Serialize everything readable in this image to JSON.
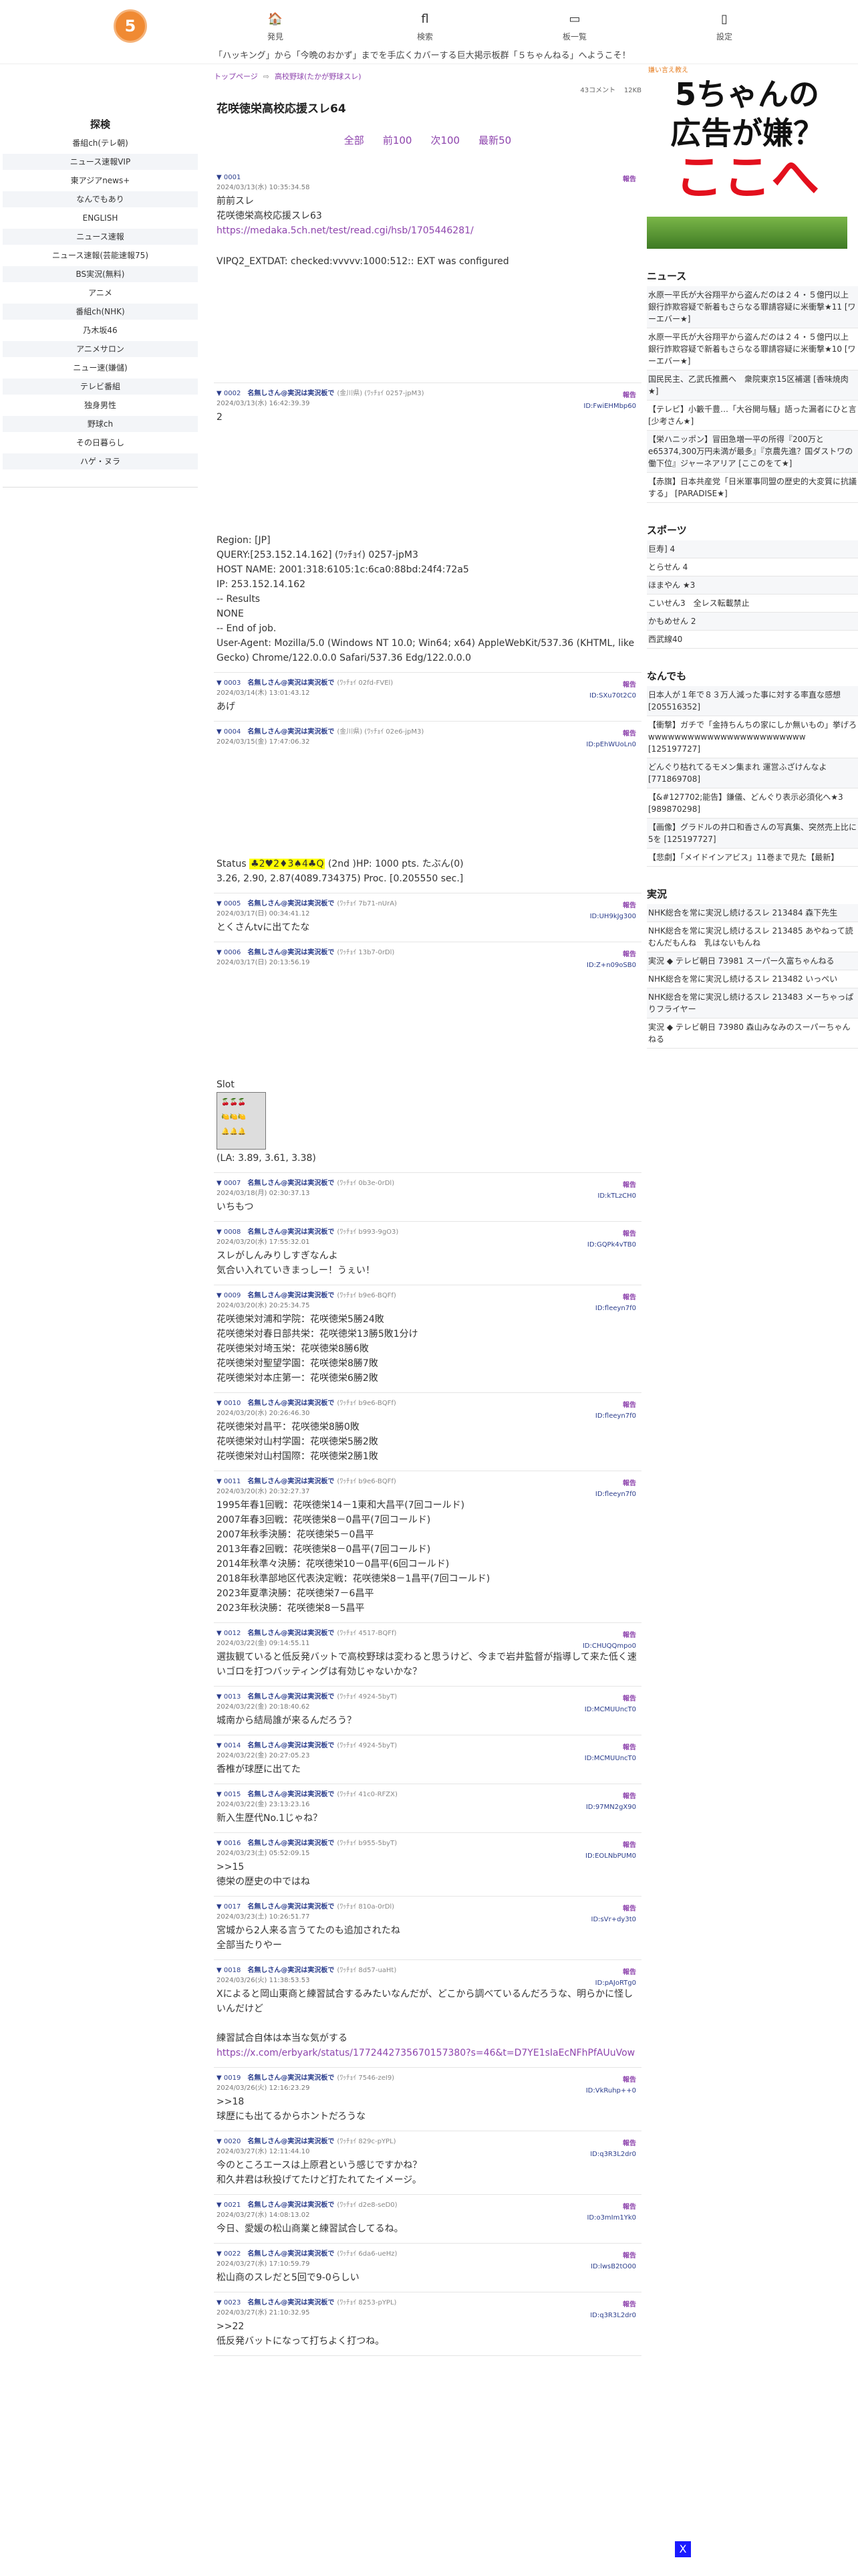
{
  "nav": {
    "logo": "5",
    "items": [
      {
        "icon": "🏠",
        "label": "発見"
      },
      {
        "icon": "fl",
        "label": "検索"
      },
      {
        "icon": "▭",
        "label": "板一覧"
      },
      {
        "icon": "▯",
        "label": "設定"
      }
    ]
  },
  "marquee": "「ハッキング」から「今晩のおかず」までを手広くカバーする巨大掲示板群「５ちゃんねる」へようこそ！",
  "sidebar": {
    "title": "探検",
    "items": [
      "番組ch(テレ朝)",
      "ニュース速報VIP",
      "東アジアnews+",
      "なんでもあり",
      "ENGLISH",
      "ニュース速報",
      "ニュース速報(芸能速報75)",
      "BS実況(無料)",
      "アニメ",
      "番組ch(NHK)",
      "乃木坂46",
      "アニメサロン",
      "ニュー速(嫌儲)",
      "テレビ番組",
      "独身男性",
      "野球ch",
      "その日暮らし",
      "ハゲ・ヌラ"
    ]
  },
  "breadcrumb": [
    "トップページ",
    "高校野球(たかが野球スレ)"
  ],
  "meta": {
    "comments": "43コメント",
    "size": "12KB"
  },
  "thread_title": "花咲徳栄高校応援スレ64",
  "pager": [
    "全部",
    "前100",
    "次100",
    "最新50"
  ],
  "report_label": "報告",
  "posts": [
    {
      "num": "0001",
      "name": "",
      "trip": "",
      "date": "2024/03/13(水) 10:35:34.58",
      "id": "",
      "body": "前前スレ\n花咲徳栄高校応援スレ63",
      "link": "https://medaka.5ch.net/test/read.cgi/hsb/1705446281/",
      "after": "\nVIPQ2_EXTDAT: checked:vvvvv:1000:512:: EXT was configured",
      "blank": true
    },
    {
      "num": "0002",
      "name": "名無しさん@実況は実況板で",
      "trip": "(金川県) (ﾜｯﾁｮｲ 0257-jpM3)",
      "date": "2024/03/13(水) 16:42:39.39",
      "id": "ID:FwiEHMbp60",
      "body": "2",
      "blank": true,
      "after2": "Region: [JP]\nQUERY:[253.152.14.162] (ﾜｯﾁｮｲ) 0257-jpM3\nHOST NAME: 2001:318:6105:1c:6ca0:88bd:24f4:72a5\nIP: 253.152.14.162\n-- Results\nNONE\n-- End of job.\nUser-Agent: Mozilla/5.0 (Windows NT 10.0; Win64; x64) AppleWebKit/537.36 (KHTML, like Gecko) Chrome/122.0.0.0 Safari/537.36 Edg/122.0.0.0"
    },
    {
      "num": "0003",
      "name": "名無しさん@実況は実況板で",
      "trip": "(ﾜｯﾁｮｲ 02fd-FVEl)",
      "date": "2024/03/14(木) 13:01:43.12",
      "id": "ID:SXu70t2C0",
      "body": "あげ"
    },
    {
      "num": "0004",
      "name": "名無しさん@実況は実況板で",
      "trip": "(金川県) (ﾜｯﾁｮｲ 02e6-jpM3)",
      "date": "2024/03/15(金) 17:47:06.32",
      "id": "ID:pEhWUoLn0",
      "body": "",
      "blank": true,
      "status": true
    },
    {
      "num": "0005",
      "name": "名無しさん@実況は実況板で",
      "trip": "(ﾜｯﾁｮｲ 7b71-nUrA)",
      "date": "2024/03/17(日) 00:34:41.12",
      "id": "ID:UH9kJg300",
      "body": "とくさんtvに出てたな"
    },
    {
      "num": "0006",
      "name": "名無しさん@実況は実況板で",
      "trip": "(ﾜｯﾁｮｲ 13b7-0rDl)",
      "date": "2024/03/17(日) 20:13:56.19",
      "id": "ID:Z+n09oSB0",
      "body": "",
      "blank": true,
      "slot": true
    },
    {
      "num": "0007",
      "name": "名無しさん@実況は実況板で",
      "trip": "(ﾜｯﾁｮｲ 0b3e-0rDl)",
      "date": "2024/03/18(月) 02:30:37.13",
      "id": "ID:kTLzCH0",
      "body": "いちもつ"
    },
    {
      "num": "0008",
      "name": "名無しさん@実況は実況板で",
      "trip": "(ﾜｯﾁｮｲ b993-9gO3)",
      "date": "2024/03/20(水) 17:55:32.01",
      "id": "ID:GQPk4vTB0",
      "body": "スレがしんみりしすぎなんよ\n気合い入れていきまっしー！うぇい！"
    },
    {
      "num": "0009",
      "name": "名無しさん@実況は実況板で",
      "trip": "(ﾜｯﾁｮｲ b9e6-BQFf)",
      "date": "2024/03/20(水) 20:25:34.75",
      "id": "ID:fleeyn7f0",
      "body": "花咲徳栄対浦和学院：花咲徳栄5勝24敗\n花咲徳栄対春日部共栄：花咲徳栄13勝5敗1分け\n花咲徳栄対埼玉栄：花咲徳栄8勝6敗\n花咲徳栄対聖望学園：花咲徳栄8勝7敗\n花咲徳栄対本庄第一：花咲徳栄6勝2敗"
    },
    {
      "num": "0010",
      "name": "名無しさん@実況は実況板で",
      "trip": "(ﾜｯﾁｮｲ b9e6-BQFf)",
      "date": "2024/03/20(水) 20:26:46.30",
      "id": "ID:fleeyn7f0",
      "body": "花咲徳栄対昌平：花咲徳栄8勝0敗\n花咲徳栄対山村学園：花咲徳栄5勝2敗\n花咲徳栄対山村国際：花咲徳栄2勝1敗"
    },
    {
      "num": "0011",
      "name": "名無しさん@実況は実況板で",
      "trip": "(ﾜｯﾁｮｲ b9e6-BQFf)",
      "date": "2024/03/20(水) 20:32:27.37",
      "id": "ID:fleeyn7f0",
      "body": "1995年春1回戦：花咲徳栄14－1東和大昌平(7回コールド)\n2007年春3回戦：花咲徳栄8－0昌平(7回コールド)\n2007年秋季決勝：花咲徳栄5－0昌平\n2013年春2回戦：花咲徳栄8－0昌平(7回コールド)\n2014年秋準々決勝：花咲徳栄10－0昌平(6回コールド)\n2018年秋準部地区代表決定戦：花咲徳栄8－1昌平(7回コールド)\n2023年夏準決勝：花咲徳栄7－6昌平\n2023年秋決勝：花咲徳栄8－5昌平"
    },
    {
      "num": "0012",
      "name": "名無しさん@実況は実況板で",
      "trip": "(ﾜｯﾁｮｲ 4517-BQFf)",
      "date": "2024/03/22(金) 09:14:55.11",
      "id": "ID:CHUQQmpo0",
      "body": "選抜観ていると低反発バットで高校野球は変わると思うけど、今まで岩井監督が指導して来た低く速いゴロを打つバッティングは有効じゃないかな？"
    },
    {
      "num": "0013",
      "name": "名無しさん@実況は実況板で",
      "trip": "(ﾜｯﾁｮｲ 4924-5byT)",
      "date": "2024/03/22(金) 20:18:40.62",
      "id": "ID:MCMUUncT0",
      "body": "城南から結局誰が来るんだろう？"
    },
    {
      "num": "0014",
      "name": "名無しさん@実況は実況板で",
      "trip": "(ﾜｯﾁｮｲ 4924-5byT)",
      "date": "2024/03/22(金) 20:27:05.23",
      "id": "ID:MCMUUncT0",
      "body": "香椎が球歴に出てた"
    },
    {
      "num": "0015",
      "name": "名無しさん@実況は実況板で",
      "trip": "(ﾜｯﾁｮｲ 41c0-RFZX)",
      "date": "2024/03/22(金) 23:13:23.16",
      "id": "ID:97MN2gX90",
      "body": "新入生歴代No.1じゃね？"
    },
    {
      "num": "0016",
      "name": "名無しさん@実況は実況板で",
      "trip": "(ﾜｯﾁｮｲ b955-5byT)",
      "date": "2024/03/23(土) 05:52:09.15",
      "id": "ID:EOLNbPUM0",
      "body": ">>15\n徳栄の歴史の中ではね",
      "quote": true
    },
    {
      "num": "0017",
      "name": "名無しさん@実況は実況板で",
      "trip": "(ﾜｯﾁｮｲ 810a-0rDl)",
      "date": "2024/03/23(土) 10:26:51.77",
      "id": "ID:sVr+dy3t0",
      "body": "宮城から2人来る言うてたのも追加されたね\n全部当たりやー"
    },
    {
      "num": "0018",
      "name": "名無しさん@実況は実況板で",
      "trip": "(ﾜｯﾁｮｲ 8d57-uaHt)",
      "date": "2024/03/26(火) 11:38:53.53",
      "id": "ID:pAJoRTg0",
      "body": "Xによると岡山東商と練習試合するみたいなんだが、どこから調べているんだろうな、明らかに怪しいんだけど\n\n練習試合自体は本当な気がする",
      "link": "https://x.com/erbyark/status/1772442735670157380?s=46&t=D7YE1sIaEcNFhPfAUuVow"
    },
    {
      "num": "0019",
      "name": "名無しさん@実況は実況板で",
      "trip": "(ﾜｯﾁｮｲ 7546-zeI9)",
      "date": "2024/03/26(火) 12:16:23.29",
      "id": "ID:VkRuhp++0",
      "body": ">>18\n球歴にも出てるからホントだろうな",
      "quote": true
    },
    {
      "num": "0020",
      "name": "名無しさん@実況は実況板で",
      "trip": "(ﾜｯﾁｮｲ 829c-pYPL)",
      "date": "2024/03/27(水) 12:11:44.10",
      "id": "ID:q3R3L2dr0",
      "body": "今のところエースは上原君という感じですかね？\n和久井君は秋投げてたけど打たれてたイメージ。"
    },
    {
      "num": "0021",
      "name": "名無しさん@実況は実況板で",
      "trip": "(ﾜｯﾁｮｲ d2e8-seD0)",
      "date": "2024/03/27(水) 14:08:13.02",
      "id": "ID:o3mIm1Yk0",
      "body": "今日、愛媛の松山商業と練習試合してるね。"
    },
    {
      "num": "0022",
      "name": "名無しさん@実況は実況板で",
      "trip": "(ﾜｯﾁｮｲ 6da6-ueHz)",
      "date": "2024/03/27(水) 17:10:59.79",
      "id": "ID:lwsB2tO00",
      "body": "松山商のスレだと5回で9-0らしい"
    },
    {
      "num": "0023",
      "name": "名無しさん@実況は実況板で",
      "trip": "(ﾜｯﾁｮｲ 8253-pYPL)",
      "date": "2024/03/27(水) 21:10:32.95",
      "id": "ID:q3R3L2dr0",
      "body": ">>22\n低反発バットになって打ちよく打つね。",
      "quote": true
    }
  ],
  "status_line": "Status ♣2♥2♦3♠4♣Q (2nd )HP: 1000 pts. たぶん(0)\n3.26, 2.90, 2.87(4089.734375) Proc. [0.205550 sec.]",
  "slot": {
    "title": "Slot",
    "rows": [
      "🍒🍒🍒",
      "🍋🍋🍋",
      "🔔🔔🔔"
    ],
    "la": "(LA: 3.89, 3.61, 3.38)"
  },
  "right": {
    "ad_head": "嫌い言え教え",
    "ad_l1": "5ちゃんの",
    "ad_l2": "広告が嫌？",
    "ad_l3": "ここへ",
    "sections": [
      {
        "title": "ニュース",
        "items": [
          "水原一平氏が大谷翔平から盗んだのは２４・５億円以上　銀行詐欺容疑で新着もさらなる罪請容疑に米衝撃★11 [ワーエバー★]",
          "水原一平氏が大谷翔平から盗んだのは２４・５億円以上　銀行詐欺容疑で新着もさらなる罪請容疑に米衝撃★10 [ワーエバー★]",
          "国民民主、乙武氏推薦へ　衆院東京15区補選 [香味焼肉★]",
          "【テレビ】小籔千豊…「大谷開与騒」語った漏者にひと言 [少考さん★]",
          "【栄ハニッポン】冒田急増一平の所得『200万とe65374,300万円未満が最多』『京農先進？国ダストワの働下位』ジャーネアリア [ここのをて★]",
          "【赤旗】日本共産党「日米軍事同盟の歴史的大変質に抗議する」 [PARADISE★]"
        ]
      },
      {
        "title": "スポーツ",
        "items": [
          "巨寿] 4",
          "とらせん 4",
          "ほまやん ★3",
          "こいせん3　全レス転載禁止",
          "かもめせん 2",
          "西武線40"
        ]
      },
      {
        "title": "なんでも",
        "items": [
          "日本人が１年で８３万人減った事に対する率直な感想 [205516352]",
          "【衝撃】ガチで「金持ちんちの家にしか無いもの」挙げろ wwwwwwwwwwwwwwwwwwwwwwww [125197727]",
          "どんぐり枯れてるモメン集まれ 運営ふざけんなよ [771869708]",
          "【&#127702;能告】鎌儀、どんぐり表示必須化へ★3 [989870298]",
          "【画像】グラドルの井口和香さんの写真集、突然売上比に5を [125197727]",
          "【悲劇】「メイドインアビス」11巻まで見た【最新】"
        ]
      },
      {
        "title": "実況",
        "items": [
          "NHK総合を常に実況し続けるスレ 213484 森下先生",
          "NHK総合を常に実況し続けるスレ 213485 あやねって読むんだもんね　乳はないもんね",
          "実況 ◆ テレビ朝日 73981 スーパー久富ちゃんねる",
          "NHK総合を常に実況し続けるスレ 213482 いっぺい",
          "NHK総合を常に実況し続けるスレ 213483 メーちゃっぱりフライヤー",
          "実況 ◆ テレビ朝日 73980 森山みなみのスーパーちゃんねる"
        ]
      }
    ]
  },
  "bottom_box": "X"
}
